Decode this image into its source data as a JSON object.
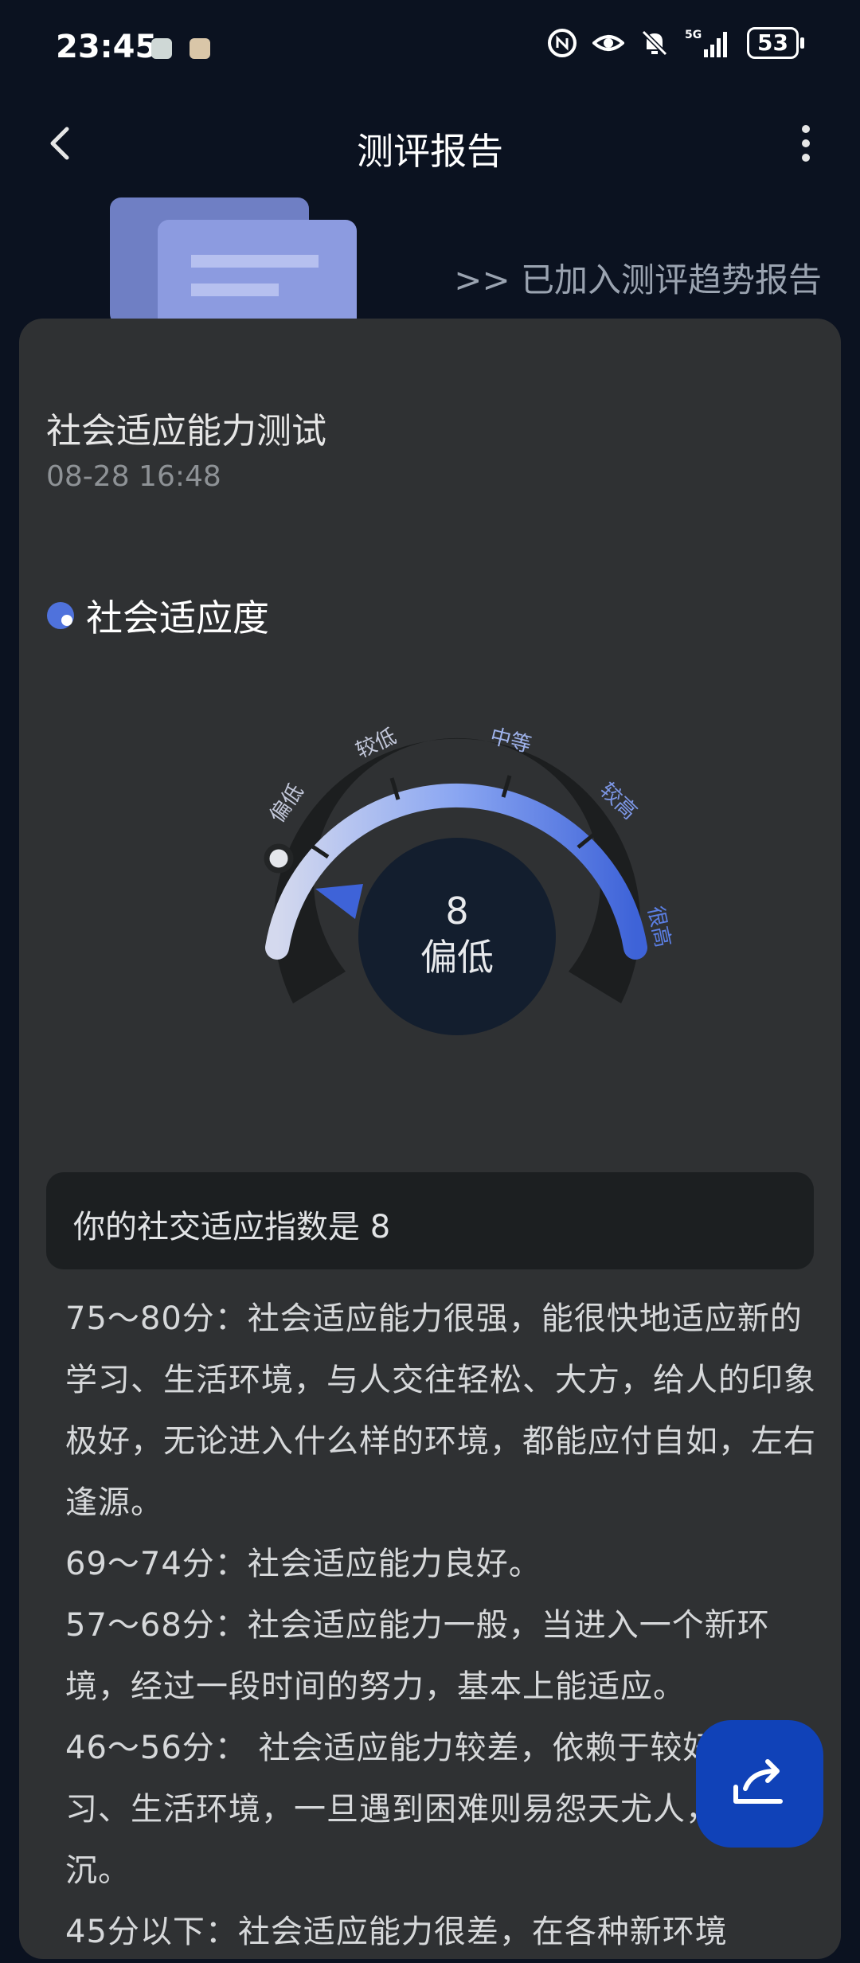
{
  "status_bar": {
    "time": "23:45",
    "battery": "53",
    "icons": [
      "app-notification-icon",
      "app-notification-icon-2",
      "nfc-icon",
      "eye-icon",
      "mute-icon",
      "5g-signal-icon",
      "battery-icon"
    ]
  },
  "app_bar": {
    "title": "测评报告",
    "back_icon": "back-arrow-icon",
    "more_icon": "more-vertical-icon"
  },
  "header": {
    "trend_link": ">> 已加入测评趋势报告"
  },
  "report": {
    "test_name": "社会适应能力测试",
    "test_date": "08-28 16:48",
    "section_title": "社会适应度",
    "gauge": {
      "score": "8",
      "level": "偏低",
      "ticks": [
        "偏低",
        "较低",
        "中等",
        "较高",
        "很高"
      ],
      "accent": "#4f72dc"
    },
    "index_text": "你的社交适应指数是 8",
    "description": [
      "75～80分：社会适应能力很强，能很快地适应新的学习、生活环境，与人交往轻松、大方，给人的印象极好，无论进入什么样的环境，都能应付自如，左右逢源。",
      "69～74分：社会适应能力良好。",
      "57～68分：社会适应能力一般，当进入一个新环境，经过一段时间的努力，基本上能适应。",
      "46～56分： 社会适应能力较差，依赖于较好的学习、生活环境，一旦遇到困难则易怨天尤人，甚至消沉。",
      "45分以下：社会适应能力很差，在各种新环境"
    ]
  },
  "share_button": {
    "icon": "share-icon",
    "color": "#1042b8"
  }
}
